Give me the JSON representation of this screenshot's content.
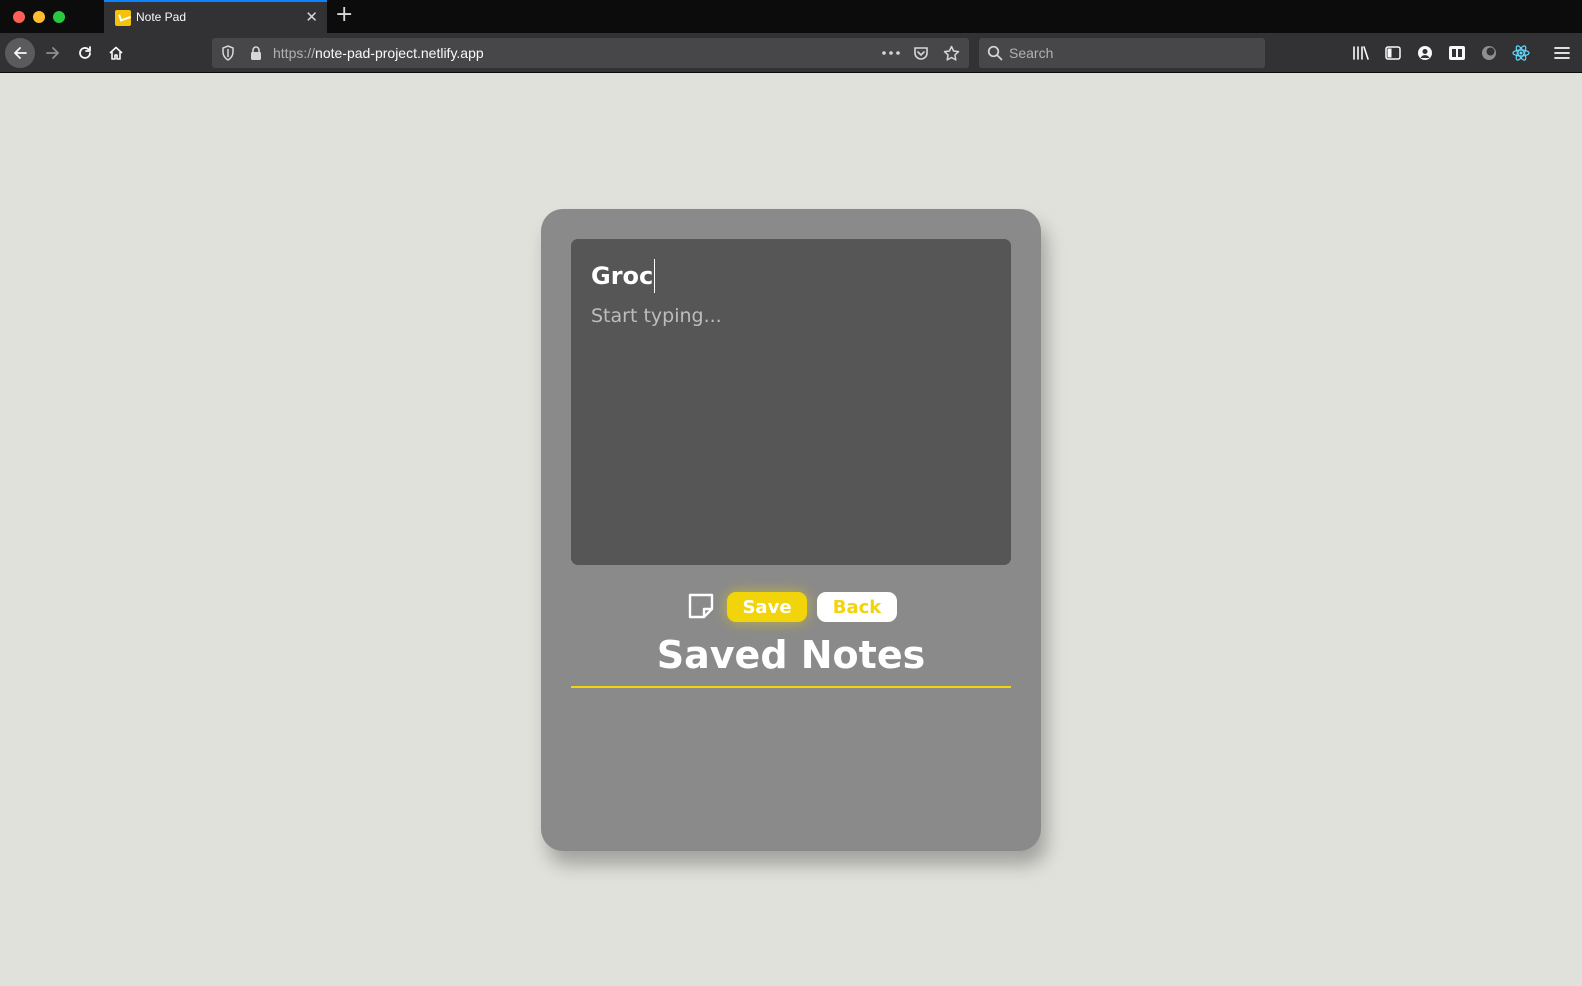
{
  "browser": {
    "tab_title": "Note Pad",
    "tab_close": "✕",
    "new_tab": "+",
    "url_scheme": "https://",
    "url_host": "note-pad-project.netlify.app",
    "search_placeholder": "Search"
  },
  "icons": {
    "back": "arrow-left-icon",
    "forward": "arrow-right-icon",
    "reload": "reload-icon",
    "home": "home-icon",
    "shield": "shield-icon",
    "lock": "lock-icon",
    "more": "more-icon",
    "pocket": "pocket-icon",
    "bookmark": "star-icon",
    "search": "search-icon",
    "toolbar": [
      "library-icon",
      "sidebar-icon",
      "account-icon",
      "extension-icon",
      "dark-circle-icon",
      "react-devtools-icon",
      "menu-icon"
    ]
  },
  "app": {
    "title_value": "Groc",
    "body_placeholder": "Start typing...",
    "body_value": "",
    "save_label": "Save",
    "back_label": "Back",
    "saved_heading": "Saved Notes"
  },
  "colors": {
    "page_bg": "#e1e1dc",
    "card_bg": "#8a8a8a",
    "editor_bg": "#565656",
    "accent": "#f2d40a",
    "chrome_dark": "#0c0c0d",
    "chrome_toolbar": "#323234"
  }
}
